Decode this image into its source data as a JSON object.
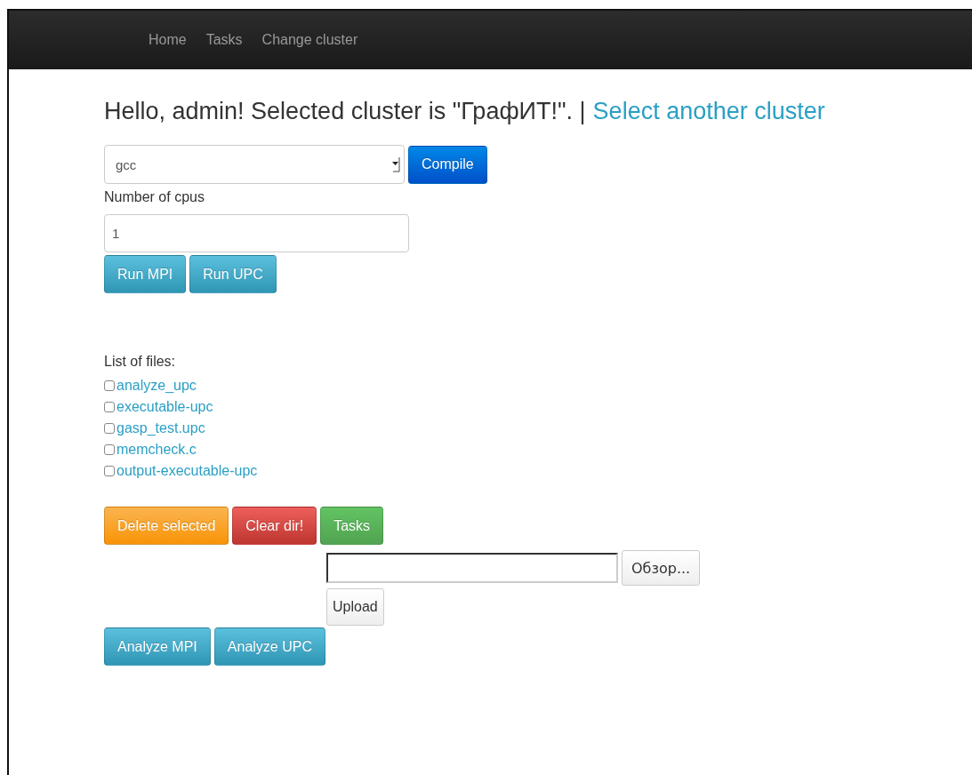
{
  "navbar": {
    "items": [
      {
        "label": "Home"
      },
      {
        "label": "Tasks"
      },
      {
        "label": "Change cluster"
      }
    ]
  },
  "heading": {
    "text": "Hello, admin! Selected cluster is \"ГрафИТ!\". |",
    "link": "Select another cluster"
  },
  "compiler_select": {
    "value": "gcc"
  },
  "compile_button": {
    "label": "Compile",
    "kind": "primary"
  },
  "cpus": {
    "label": "Number of cpus",
    "value": "1"
  },
  "run_buttons": [
    {
      "label": "Run MPI",
      "kind": "info"
    },
    {
      "label": "Run UPC",
      "kind": "info"
    }
  ],
  "files": {
    "label": "List of files:",
    "items": [
      {
        "name": "analyze_upc",
        "checked": false
      },
      {
        "name": "executable-upc",
        "checked": false
      },
      {
        "name": "gasp_test.upc",
        "checked": false
      },
      {
        "name": "memcheck.c",
        "checked": false
      },
      {
        "name": "output-executable-upc",
        "checked": false
      }
    ]
  },
  "action_buttons": [
    {
      "label": "Delete selected",
      "kind": "warning"
    },
    {
      "label": "Clear dir!",
      "kind": "danger"
    },
    {
      "label": "Tasks",
      "kind": "success"
    }
  ],
  "upload": {
    "browse_label": "Обзор...",
    "upload_label": "Upload"
  },
  "analyze_buttons": [
    {
      "label": "Analyze MPI",
      "kind": "info"
    },
    {
      "label": "Analyze UPC",
      "kind": "info"
    }
  ]
}
